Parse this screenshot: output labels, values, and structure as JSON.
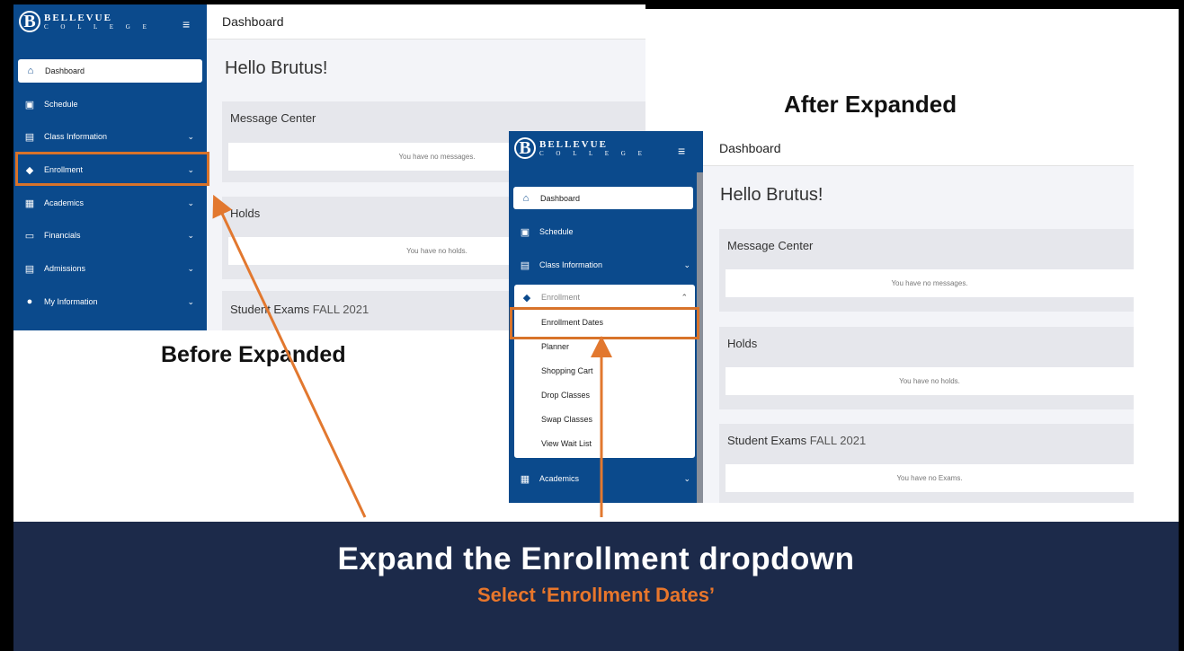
{
  "brand": {
    "name": "BELLEVUE",
    "sub": "C O L L E G E",
    "initial": "B"
  },
  "page_title": "Dashboard",
  "greeting": "Hello Brutus!",
  "labels": {
    "after": "After Expanded",
    "before": "Before Expanded"
  },
  "banner": {
    "title": "Expand the Enrollment dropdown",
    "subtitle": "Select ‘Enrollment Dates’"
  },
  "nav": {
    "dashboard": "Dashboard",
    "schedule": "Schedule",
    "class_information": "Class Information",
    "enrollment": "Enrollment",
    "academics": "Academics",
    "financials": "Financials",
    "admissions": "Admissions",
    "my_information": "My Information"
  },
  "enrollment_submenu": [
    "Enrollment Dates",
    "Planner",
    "Shopping Cart",
    "Drop Classes",
    "Swap Classes",
    "View Wait List"
  ],
  "cards": {
    "messages": {
      "title": "Message Center",
      "body": "You have no messages."
    },
    "holds": {
      "title": "Holds",
      "body": "You have no holds."
    },
    "exams": {
      "title": "Student Exams",
      "term": "FALL 2021",
      "body": "You have no Exams."
    }
  },
  "colors": {
    "sidebar": "#0b4a8c",
    "banner": "#1c2a4a",
    "accent": "#e8762b"
  },
  "icons": {
    "dashboard": "home-icon",
    "schedule": "calendar-icon",
    "class_information": "id-card-icon",
    "enrollment": "graduation-cap-icon",
    "academics": "documents-icon",
    "financials": "credit-card-icon",
    "admissions": "id-card-icon",
    "my_information": "info-circle-icon",
    "menu": "hamburger-icon"
  }
}
